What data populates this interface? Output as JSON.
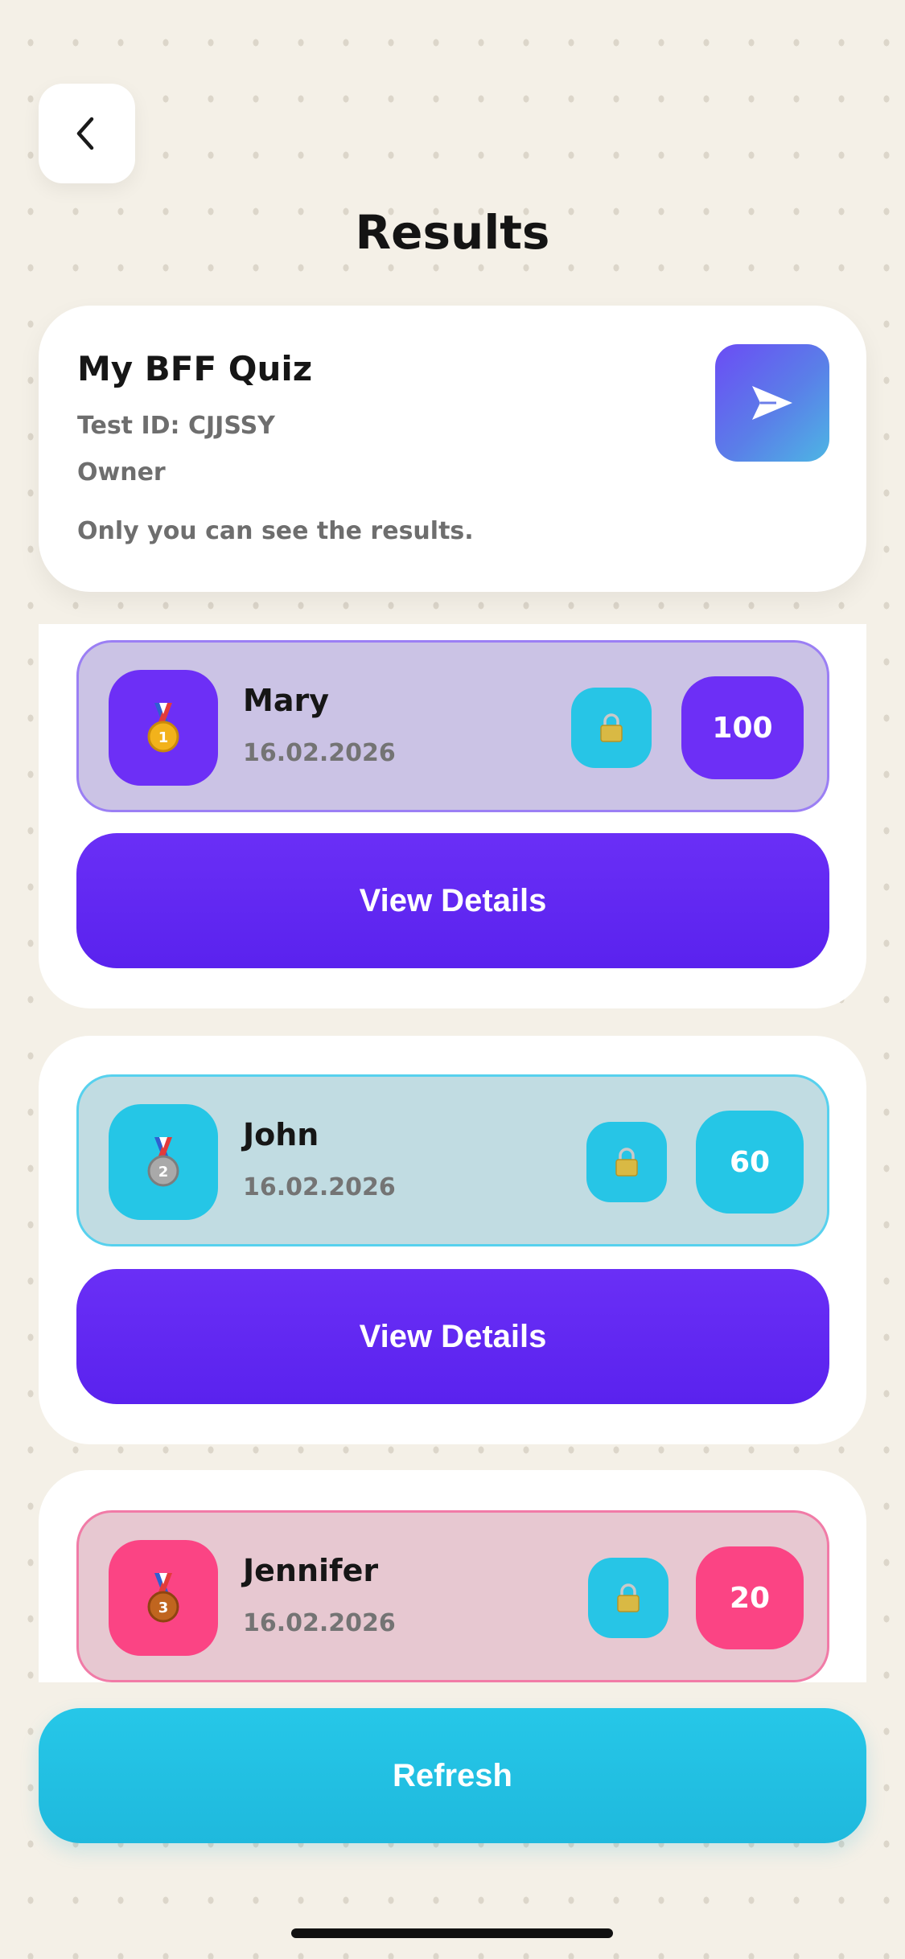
{
  "header": {
    "back_icon": "chevron-left-icon",
    "title": "Results"
  },
  "quiz": {
    "title": "My BFF Quiz",
    "test_id": "Test ID: CJJSSY",
    "role": "Owner",
    "note": "Only you can see the results.",
    "share_icon": "paper-plane-icon"
  },
  "results": [
    {
      "rank": "1",
      "medal_icon": "gold-medal-icon",
      "name": "Mary",
      "date": "16.02.2026",
      "score": "100",
      "lock_icon": "lock-icon",
      "action_label": "View Details",
      "color": "#6d2ff6"
    },
    {
      "rank": "2",
      "medal_icon": "silver-medal-icon",
      "name": "John",
      "date": "16.02.2026",
      "score": "60",
      "lock_icon": "lock-icon",
      "action_label": "View Details",
      "color": "#25c6e6"
    },
    {
      "rank": "3",
      "medal_icon": "bronze-medal-icon",
      "name": "Jennifer",
      "date": "16.02.2026",
      "score": "20",
      "lock_icon": "lock-icon",
      "color": "#fb4484"
    }
  ],
  "footer": {
    "refresh_label": "Refresh"
  },
  "colors": {
    "primary": "#6d2ff6",
    "accent": "#25c6e6",
    "pink": "#fb4484",
    "background": "#f4f0e7"
  }
}
